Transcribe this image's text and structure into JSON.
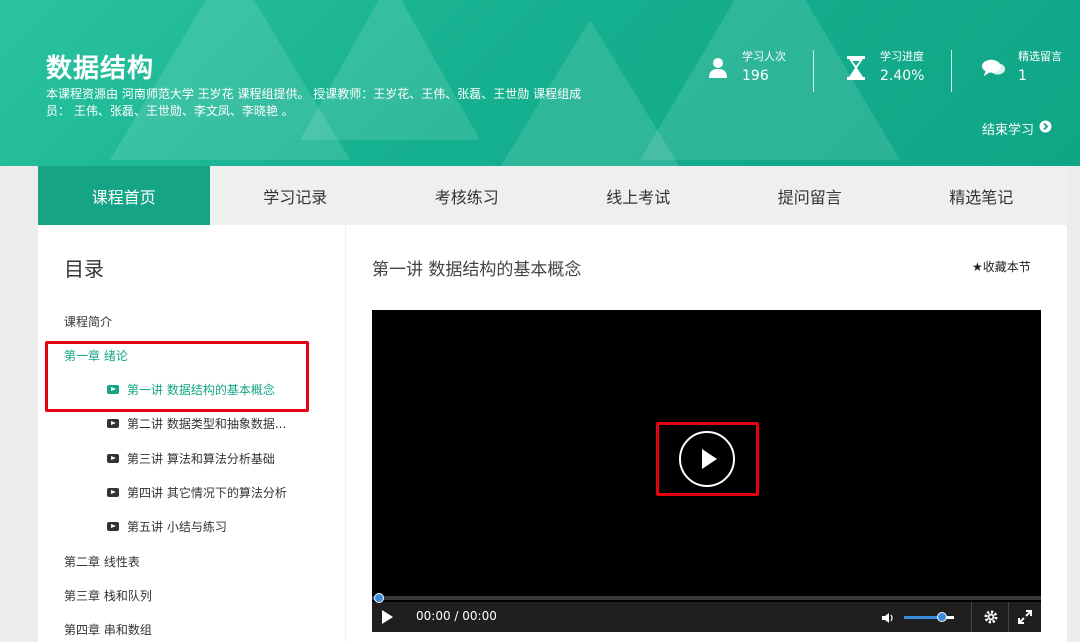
{
  "header": {
    "course_title": "数据结构",
    "course_desc": "本课程资源由  河南师范大学  王岁花  课程组提供。    授课教师：王岁花、王伟、张磊、王世勋  课程组成员： 王伟、张磊、王世勋、李文凤、李晓艳 。",
    "stats": [
      {
        "label": "学习人次",
        "value": "196",
        "icon": "user-icon"
      },
      {
        "label": "学习进度",
        "value": "2.40%",
        "icon": "hourglass-icon"
      },
      {
        "label": "精选留言",
        "value": "1",
        "icon": "chat-bubbles-icon"
      }
    ],
    "end_study_label": "结束学习"
  },
  "tabs": [
    {
      "label": "课程首页",
      "active": true
    },
    {
      "label": "学习记录"
    },
    {
      "label": "考核练习"
    },
    {
      "label": "线上考试"
    },
    {
      "label": "提问留言"
    },
    {
      "label": "精选笔记"
    }
  ],
  "toc": {
    "title": "目录",
    "intro": "课程简介",
    "chapter1": "第一章 绪论",
    "lessons": [
      "第一讲 数据结构的基本概念",
      "第二讲 数据类型和抽象数据...",
      "第三讲 算法和算法分析基础",
      "第四讲 其它情况下的算法分析",
      "第五讲 小结与练习"
    ],
    "chapter2": "第二章 线性表",
    "chapter3": "第三章 栈和队列",
    "chapter4": "第四章 串和数组"
  },
  "main": {
    "lesson_title": "第一讲 数据结构的基本概念",
    "favorite_label": "★收藏本节"
  },
  "player": {
    "time": "00:00 / 00:00",
    "progress": 0,
    "volume": 0.75
  },
  "colors": {
    "accent": "#15a485",
    "highlight_box": "#e60012",
    "player_accent": "#3a8dde"
  }
}
